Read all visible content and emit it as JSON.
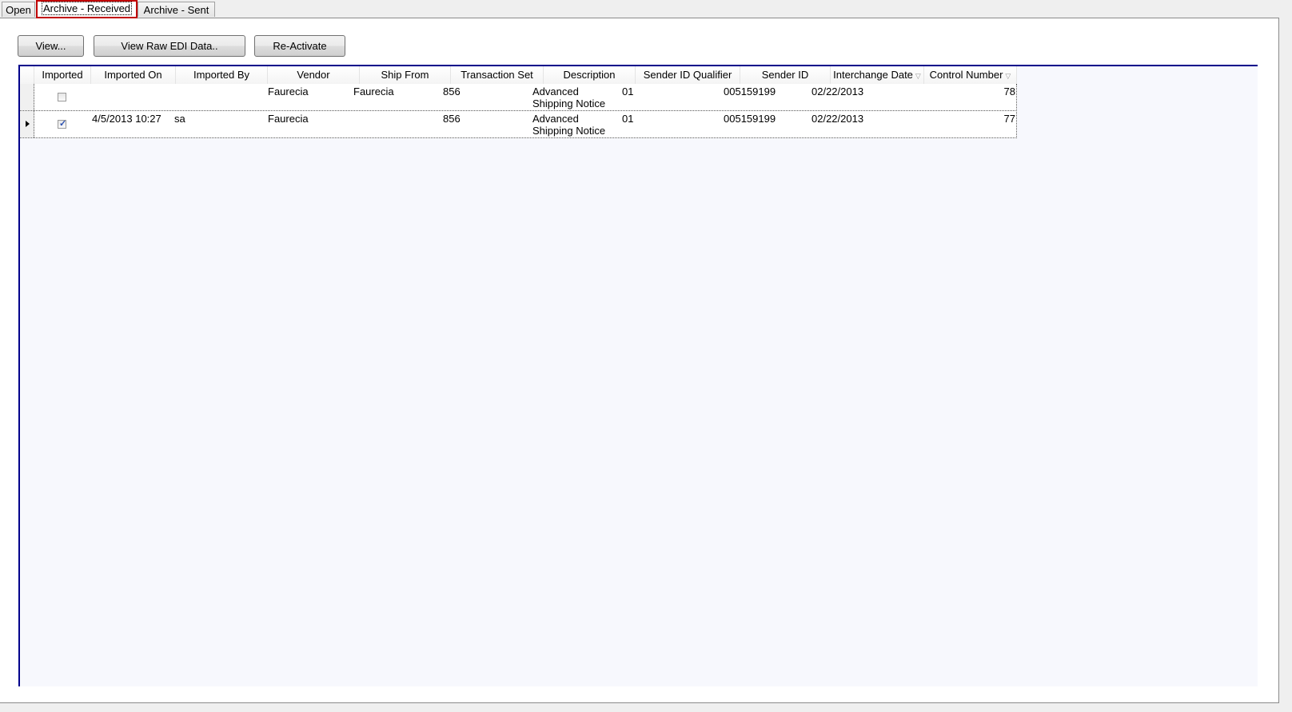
{
  "tabs": [
    {
      "label": "Open",
      "active": false
    },
    {
      "label": "Archive - Received",
      "active": true
    },
    {
      "label": "Archive - Sent",
      "active": false
    }
  ],
  "toolbar": {
    "view_label": "View...",
    "view_raw_label": "View Raw EDI Data..",
    "reactivate_label": "Re-Activate"
  },
  "grid": {
    "columns": [
      {
        "label": "Imported",
        "filter": false
      },
      {
        "label": "Imported On",
        "filter": false
      },
      {
        "label": "Imported By",
        "filter": false
      },
      {
        "label": "Vendor",
        "filter": false
      },
      {
        "label": "Ship From",
        "filter": false
      },
      {
        "label": "Transaction Set",
        "filter": false
      },
      {
        "label": "Description",
        "filter": false
      },
      {
        "label": "Sender ID Qualifier",
        "filter": false
      },
      {
        "label": "Sender ID",
        "filter": false
      },
      {
        "label": "Interchange Date",
        "filter": true
      },
      {
        "label": "Control Number",
        "filter": true
      }
    ],
    "filter_icon": "▽",
    "rows": [
      {
        "imported": false,
        "imported_on": "",
        "imported_by": "",
        "vendor": "Faurecia",
        "ship_from": "Faurecia",
        "transaction_set": "856",
        "description_line1": "Advanced",
        "description_line2": "Shipping Notice",
        "sender_id_qualifier": "01",
        "sender_id": "005159199",
        "interchange_date": "02/22/2013",
        "control_number": "78",
        "current": false
      },
      {
        "imported": true,
        "imported_on": "4/5/2013 10:27",
        "imported_by": "sa",
        "vendor": "Faurecia",
        "ship_from": "",
        "transaction_set": "856",
        "description_line1": "Advanced",
        "description_line2": "Shipping Notice",
        "sender_id_qualifier": "01",
        "sender_id": "005159199",
        "interchange_date": "02/22/2013",
        "control_number": "77",
        "current": true
      }
    ]
  },
  "colors": {
    "active_tab_border": "#c00000",
    "grid_border": "#00008b",
    "grid_background": "#f7f8fd",
    "check_color": "#2a4fb0"
  }
}
